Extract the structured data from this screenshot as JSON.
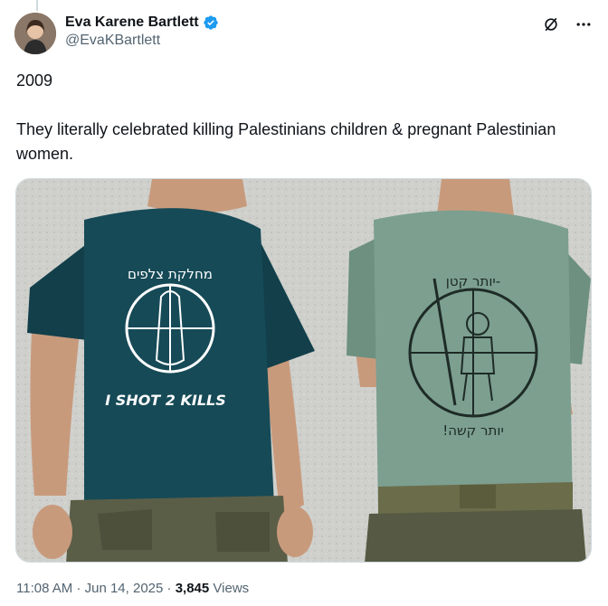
{
  "author": {
    "display_name": "Eva Karene Bartlett",
    "handle": "@EvaKBartlett",
    "verified": true,
    "verified_color": "#1d9bf0"
  },
  "tweet": {
    "line1": "2009",
    "line2": "They literally celebrated killing Palestinians children & pregnant Palestinian women."
  },
  "media": {
    "left_shirt_text": "I SHOT 2 KILLS",
    "left_shirt_hebrew": "מחלקת צלפים",
    "right_shirt_top": "יותר קטן-",
    "right_shirt_bottom": "!יותר קשה",
    "left_shirt_color": "#164a57",
    "right_shirt_color": "#7c9f90"
  },
  "meta": {
    "time": "11:08 AM",
    "date": "Jun 14, 2025",
    "separator": "·",
    "views_count": "3,845",
    "views_label": "Views"
  },
  "icons": {
    "grok": "grok-icon",
    "more": "more-icon",
    "verified": "verified-badge-icon"
  },
  "colors": {
    "text": "#0f1419",
    "secondary": "#536471"
  }
}
